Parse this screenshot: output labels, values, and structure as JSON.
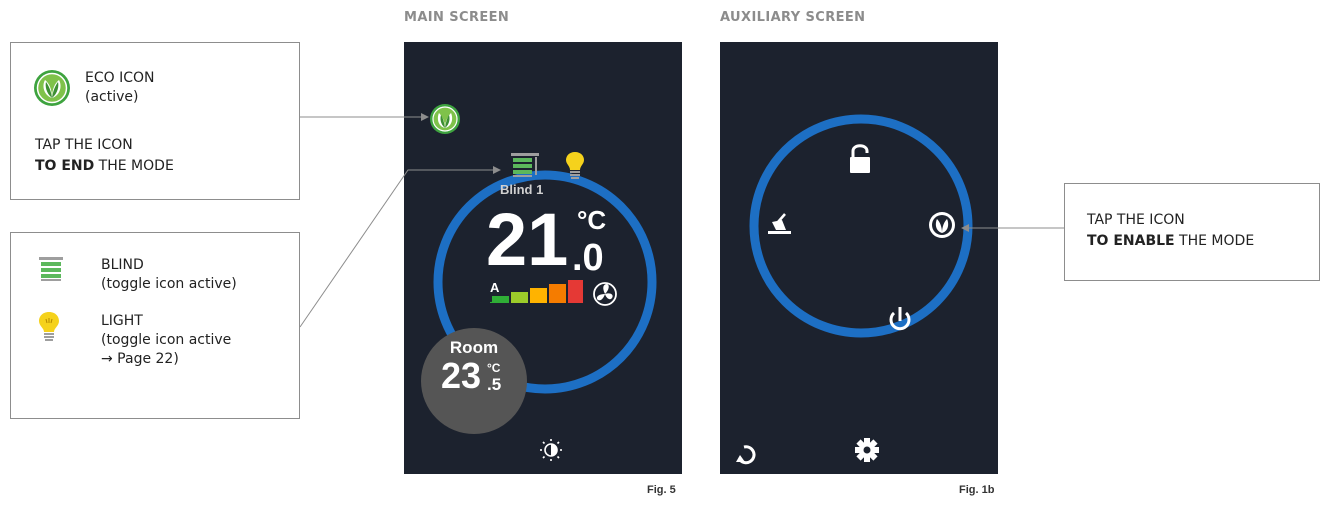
{
  "headings": {
    "main": "MAIN SCREEN",
    "aux": "AUXILIARY SCREEN"
  },
  "figures": {
    "main": "Fig. 5",
    "aux": "Fig. 1b"
  },
  "eco_callout": {
    "title": "ECO ICON",
    "subtitle": "(active)",
    "line1": "TAP THE ICON",
    "line2_bold": "TO END",
    "line2_rest": " THE MODE"
  },
  "legend_callout": {
    "blind_title": "BLIND",
    "blind_sub": "(toggle icon active)",
    "light_title": "LIGHT",
    "light_sub1": "(toggle icon active",
    "light_sub2": "→ Page 22)"
  },
  "enable_callout": {
    "line1": "TAP THE ICON",
    "line2_bold": "TO ENABLE",
    "line2_rest": " THE MODE"
  },
  "main_screen": {
    "blind_label": "Blind 1",
    "setpoint_int": "21",
    "setpoint_unit": "°C",
    "setpoint_dec": ".0",
    "fan_mode": "A",
    "fan_levels_active": 5,
    "room_label": "Room",
    "room_int": "23",
    "room_unit": "°C",
    "room_dec": ".5"
  },
  "colors": {
    "screen_bg": "#1c222e",
    "ring": "#1d6fc4",
    "eco_green": "#4caf50",
    "bulb_yellow": "#f5d21c",
    "fan_bar_colors": [
      "#2fae36",
      "#9ccc2a",
      "#ffb300",
      "#f57c00",
      "#e53935"
    ]
  }
}
